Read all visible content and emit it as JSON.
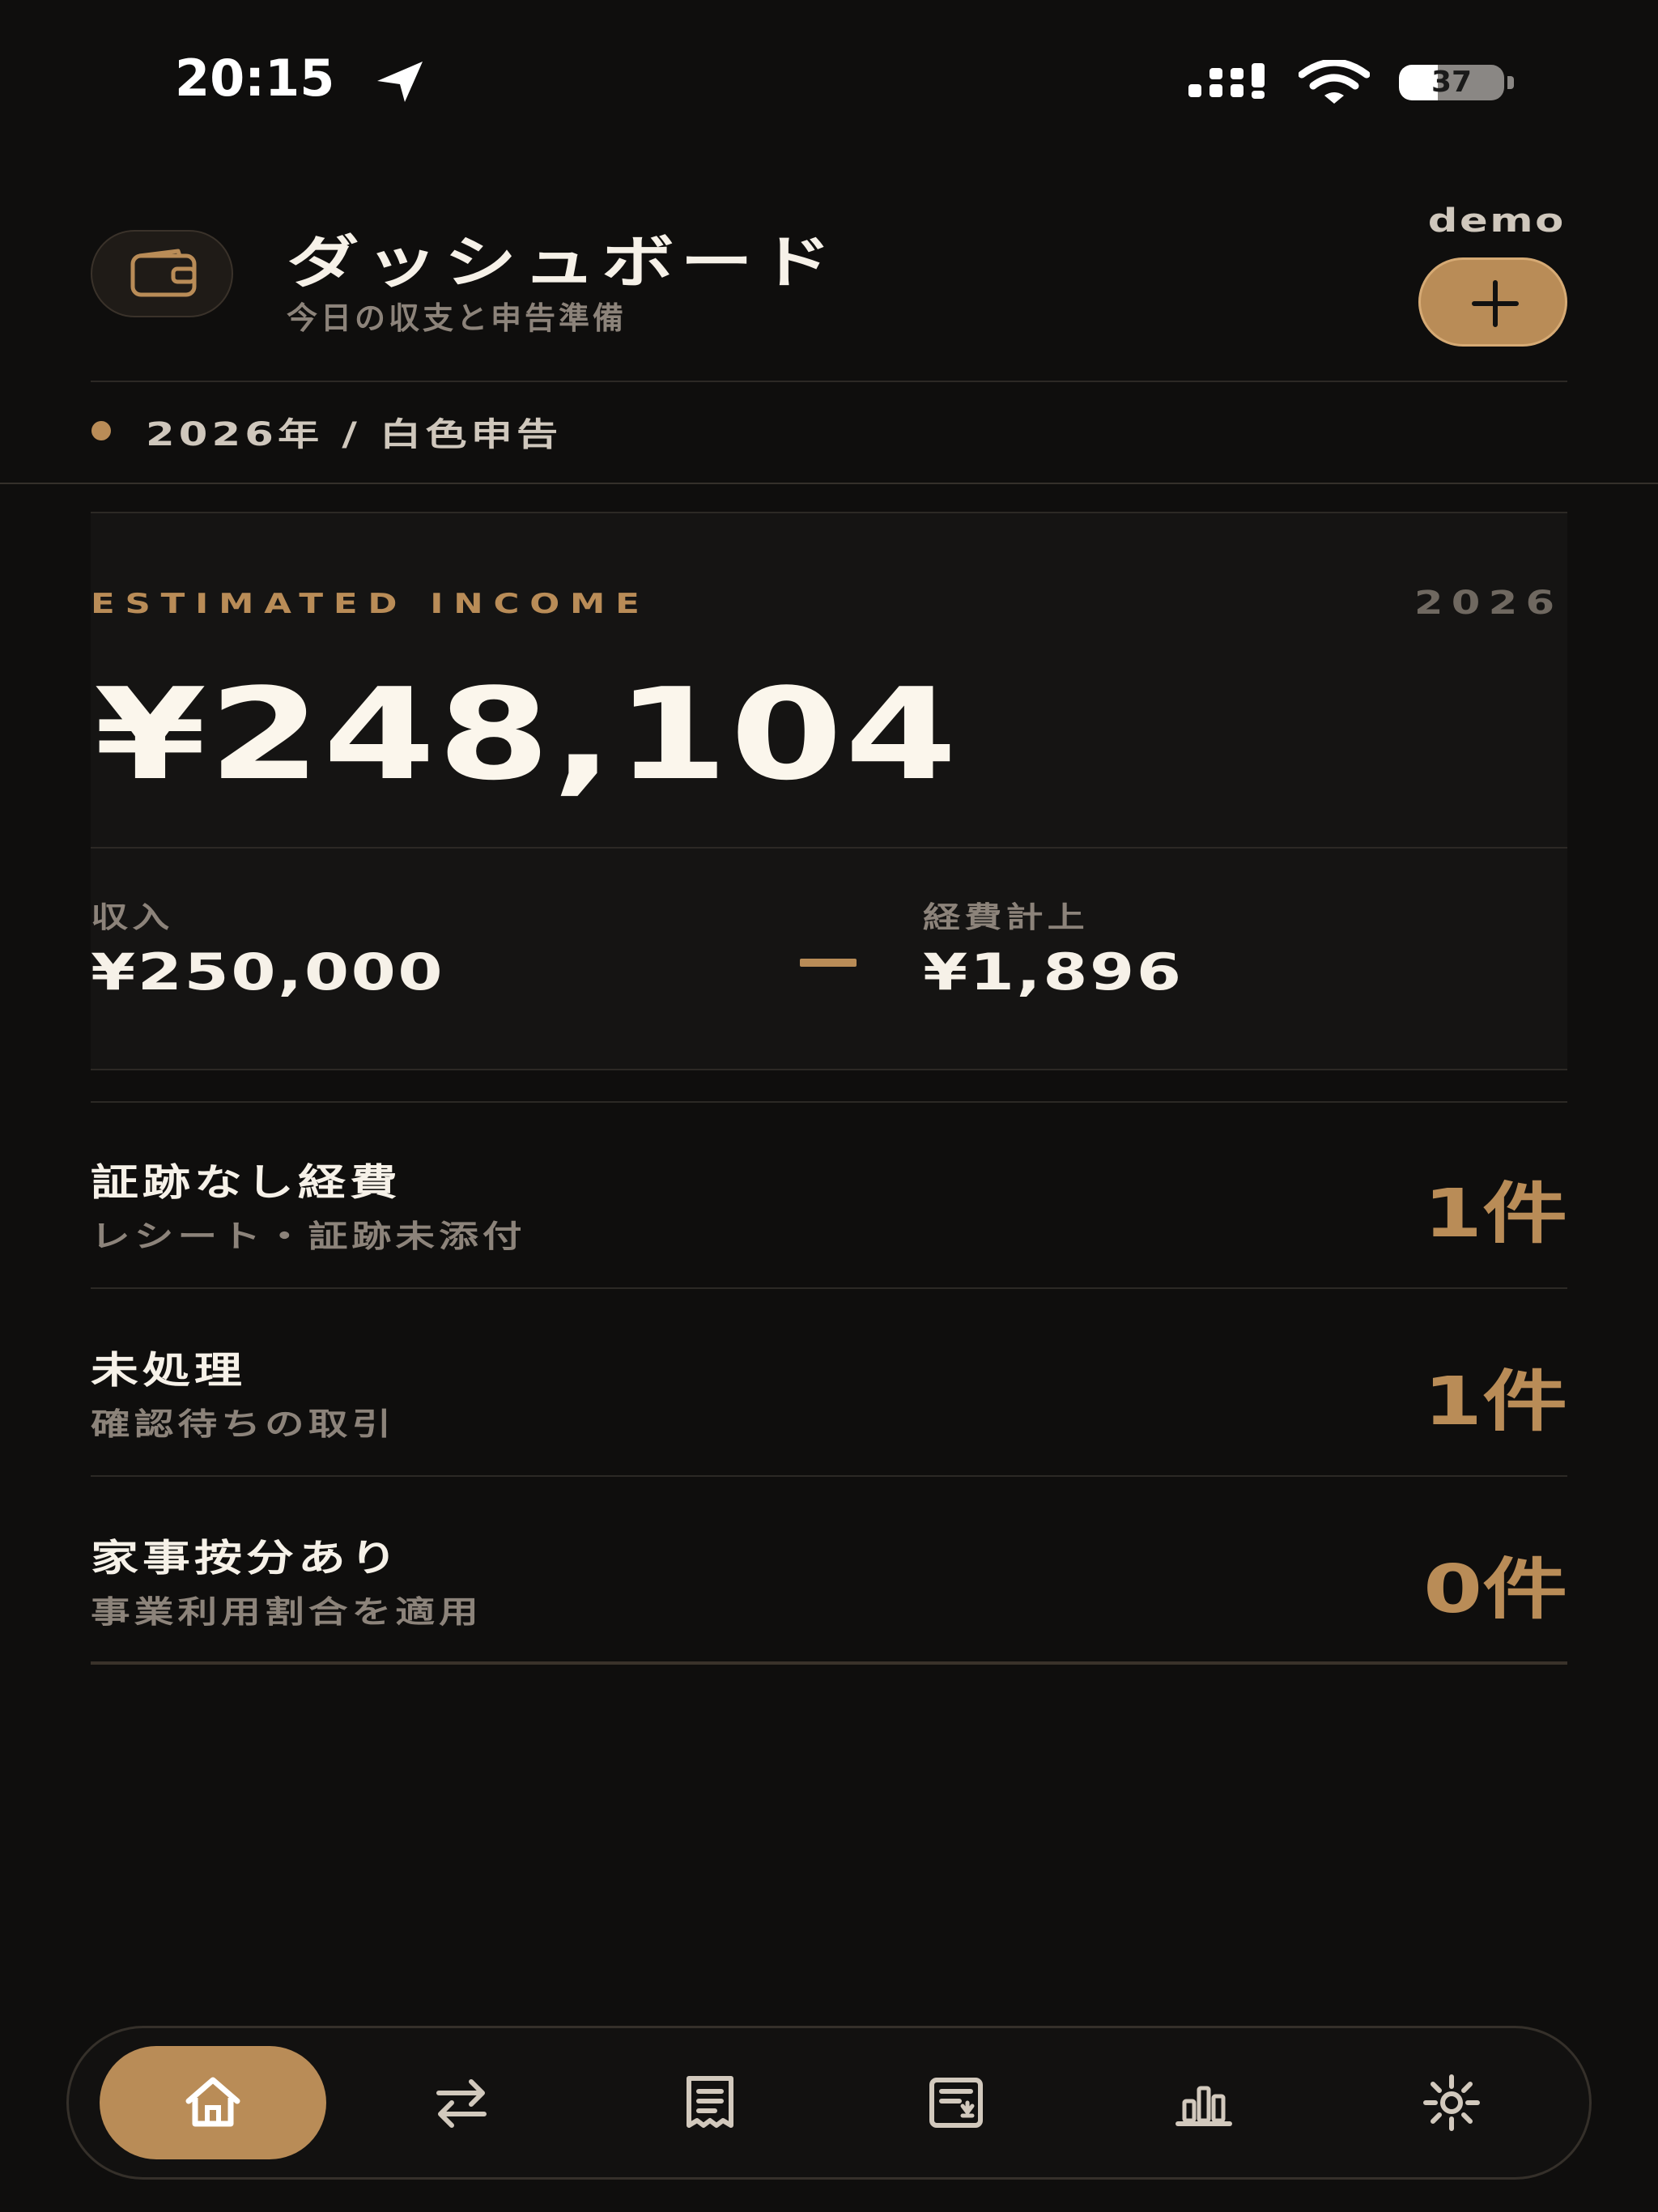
{
  "status_bar": {
    "time": "20:15",
    "battery": "37",
    "battery_level": 0.37
  },
  "header": {
    "icon": "wallet-icon",
    "title": "ダッシュボード",
    "subtitle": "今日の収支と申告準備",
    "user": "demo",
    "add_icon": "plus-icon"
  },
  "year_filter": {
    "label": "2026年 / 白色申告"
  },
  "income_card": {
    "label": "ESTIMATED INCOME",
    "year": "2026",
    "amount": "¥248,104",
    "income_label": "収入",
    "income_value": "¥250,000",
    "expense_label": "経費計上",
    "expense_value": "¥1,896"
  },
  "checklist": [
    {
      "title": "証跡なし経費",
      "subtitle": "レシート・証跡未添付",
      "count": "1件"
    },
    {
      "title": "未処理",
      "subtitle": "確認待ちの取引",
      "count": "1件"
    },
    {
      "title": "家事按分あり",
      "subtitle": "事業利用割合を適用",
      "count": "0件"
    }
  ],
  "tabbar": {
    "active": "home",
    "tabs": [
      "home-icon",
      "transfer-icon",
      "ledger-icon",
      "invoice-icon",
      "chart-icon",
      "settings-icon"
    ]
  },
  "colors": {
    "background": "#0f0e0d",
    "accent": "#b98c57",
    "text": "#f6f1e8",
    "muted": "#8c837a"
  }
}
